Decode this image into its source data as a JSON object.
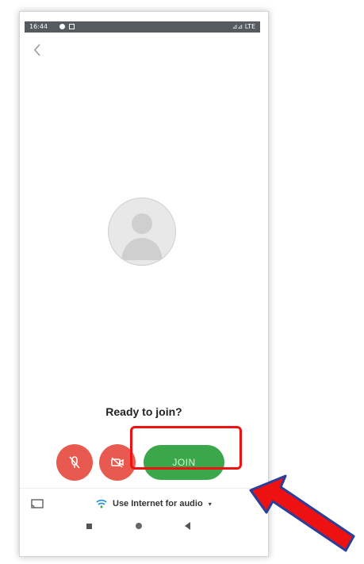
{
  "status_bar": {
    "time": "16:44",
    "right": "⊿⊿ LTE"
  },
  "prompt": {
    "title": "Ready to join?"
  },
  "controls": {
    "join_label": "JOIN"
  },
  "audio": {
    "label": "Use Internet for audio",
    "caret": "▾"
  },
  "colors": {
    "join_green": "#3aa84a",
    "mute_red": "#e85a4f",
    "highlight_red": "#ee1111",
    "arrow_blue": "#2a3f9a"
  },
  "icons": [
    "back-chevron-icon",
    "person-icon",
    "mic-off-icon",
    "camera-off-icon",
    "cast-icon",
    "wifi-icon",
    "nav-square-icon",
    "nav-home-icon",
    "nav-back-icon"
  ]
}
